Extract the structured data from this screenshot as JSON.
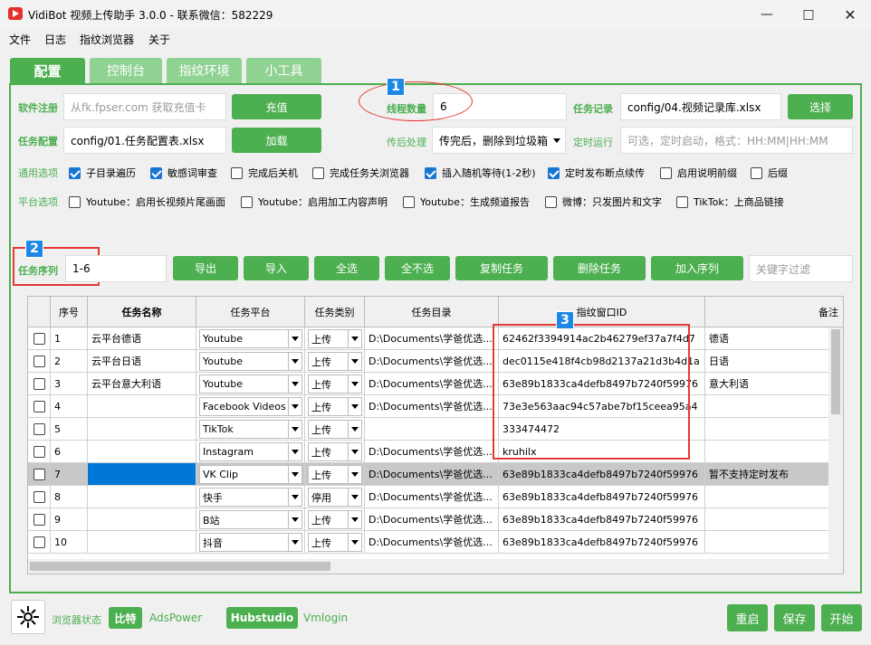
{
  "window": {
    "title": "VidiBot 视频上传助手 3.0.0 - 联系微信：582229"
  },
  "menu": [
    "文件",
    "日志",
    "指纹浏览器",
    "关于"
  ],
  "tabs": [
    "配置",
    "控制台",
    "指纹环境",
    "小工具"
  ],
  "config": {
    "software_reg_label": "软件注册",
    "software_reg_placeholder": "从fk.fpser.com 获取充值卡",
    "recharge_btn": "充值",
    "thread_count_label": "线程数量",
    "thread_count_value": "6",
    "task_record_label": "任务记录",
    "task_record_value": "config/04.视频记录库.xlsx",
    "choose_btn": "选择",
    "task_config_label": "任务配置",
    "task_config_value": "config/01.任务配置表.xlsx",
    "load_btn": "加载",
    "post_process_label": "传后处理",
    "post_process_value": "传完后，删除到垃圾箱",
    "schedule_label": "定时运行",
    "schedule_placeholder": "可选，定时启动，格式：HH:MM|HH:MM",
    "general_label": "通用选项",
    "general_options": [
      {
        "label": "子目录遍历",
        "checked": true
      },
      {
        "label": "敏感词审查",
        "checked": true
      },
      {
        "label": "完成后关机",
        "checked": false
      },
      {
        "label": "完成任务关浏览器",
        "checked": false
      },
      {
        "label": "插入随机等待(1-2秒)",
        "checked": true
      },
      {
        "label": "定时发布断点续传",
        "checked": true
      },
      {
        "label": "启用说明前缀",
        "checked": false
      },
      {
        "label": "后缀",
        "checked": false
      }
    ],
    "platform_label": "平台选项",
    "platform_options": [
      {
        "label": "Youtube：启用长视频片尾画面",
        "checked": false
      },
      {
        "label": "Youtube：启用加工内容声明",
        "checked": false
      },
      {
        "label": "Youtube：生成频道报告",
        "checked": false
      },
      {
        "label": "微博：只发图片和文字",
        "checked": false
      },
      {
        "label": "TikTok：上商品链接",
        "checked": false
      }
    ]
  },
  "markers": [
    "1",
    "2",
    "3"
  ],
  "toolbar": {
    "task_seq_label": "任务序列",
    "task_seq_value": "1-6",
    "export": "导出",
    "import": "导入",
    "select_all": "全选",
    "select_none": "全不选",
    "copy_task": "复制任务",
    "delete_task": "删除任务",
    "add_to_seq": "加入序列",
    "filter_placeholder": "关键字过滤"
  },
  "table": {
    "headers": [
      "序号",
      "任务名称",
      "任务平台",
      "任务类别",
      "任务目录",
      "指纹窗口ID",
      "备注"
    ],
    "rows": [
      {
        "no": "1",
        "name": "云平台德语",
        "platform": "Youtube",
        "type": "上传",
        "dir": "D:\\Documents\\学爸优选...",
        "fid": "62462f3394914ac2b46279ef37a7f4d7",
        "note": "德语"
      },
      {
        "no": "2",
        "name": "云平台日语",
        "platform": "Youtube",
        "type": "上传",
        "dir": "D:\\Documents\\学爸优选...",
        "fid": "dec0115e418f4cb98d2137a21d3b4d1a",
        "note": "日语"
      },
      {
        "no": "3",
        "name": "云平台意大利语",
        "platform": "Youtube",
        "type": "上传",
        "dir": "D:\\Documents\\学爸优选...",
        "fid": "63e89b1833ca4defb8497b7240f59976",
        "note": "意大利语"
      },
      {
        "no": "4",
        "name": "",
        "platform": "Facebook Videos",
        "type": "上传",
        "dir": "D:\\Documents\\学爸优选...",
        "fid": "73e3e563aac94c57abe7bf15ceea95a4",
        "note": ""
      },
      {
        "no": "5",
        "name": "",
        "platform": "TikTok",
        "type": "上传",
        "dir": "",
        "fid": "333474472",
        "note": ""
      },
      {
        "no": "6",
        "name": "",
        "platform": "Instagram",
        "type": "上传",
        "dir": "D:\\Documents\\学爸优选...",
        "fid": "kruhilx",
        "note": ""
      },
      {
        "no": "7",
        "name": "",
        "platform": "VK Clip",
        "type": "上传",
        "dir": "D:\\Documents\\学爸优选...",
        "fid": "63e89b1833ca4defb8497b7240f59976",
        "note": "暂不支持定时发布"
      },
      {
        "no": "8",
        "name": "",
        "platform": "快手",
        "type": "停用",
        "dir": "D:\\Documents\\学爸优选...",
        "fid": "63e89b1833ca4defb8497b7240f59976",
        "note": ""
      },
      {
        "no": "9",
        "name": "",
        "platform": "B站",
        "type": "上传",
        "dir": "D:\\Documents\\学爸优选...",
        "fid": "63e89b1833ca4defb8497b7240f59976",
        "note": ""
      },
      {
        "no": "10",
        "name": "",
        "platform": "抖音",
        "type": "上传",
        "dir": "D:\\Documents\\学爸优选...",
        "fid": "63e89b1833ca4defb8497b7240f59976",
        "note": ""
      }
    ]
  },
  "footer": {
    "browser_status_label": "浏览器状态",
    "browsers": [
      "比特",
      "AdsPower",
      "Hubstudio",
      "Vmlogin"
    ],
    "restart": "重启",
    "save": "保存",
    "start": "开始"
  }
}
